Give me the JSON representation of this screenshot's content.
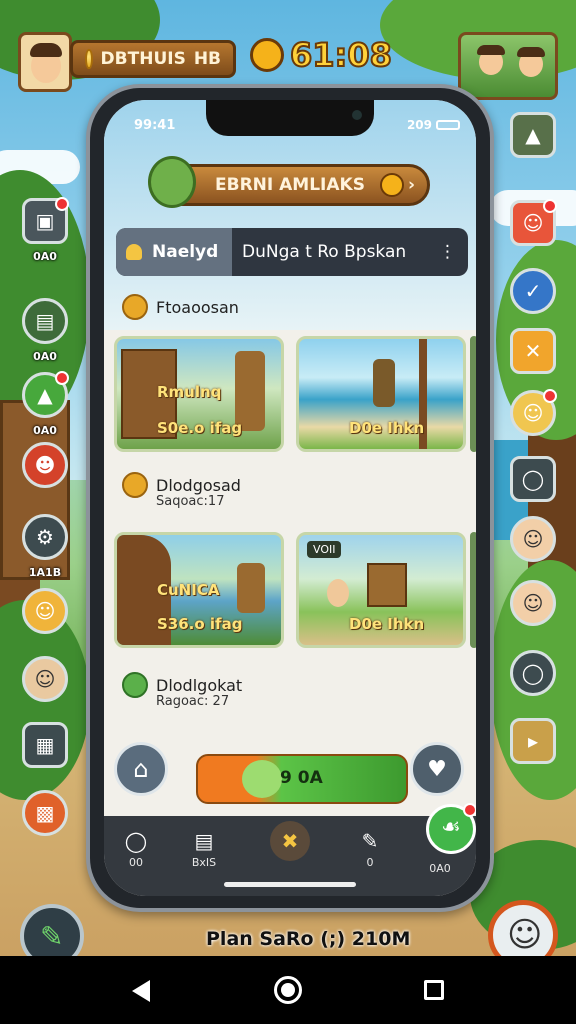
{
  "hud": {
    "player_name": "DBTHUIS",
    "player_suffix": "HB",
    "timer": "61:08"
  },
  "side_left": [
    {
      "label": "0A0",
      "icon": "store-icon"
    },
    {
      "label": "0A0",
      "icon": "map-icon"
    },
    {
      "label": "0A0",
      "icon": "chest-icon"
    },
    {
      "label": "",
      "icon": "mascot-icon"
    },
    {
      "label": "1A1B",
      "icon": "settings-icon"
    },
    {
      "label": "",
      "icon": "explorer-avatar-icon"
    },
    {
      "label": "",
      "icon": "villager-avatar-icon"
    },
    {
      "label": "",
      "icon": "grid-icon"
    },
    {
      "label": "",
      "icon": "calendar-icon"
    }
  ],
  "phone": {
    "status_time": "99:41",
    "status_right": "209",
    "title": "EBRNI AMLIAKS",
    "search": {
      "left_label": "Naelyd",
      "right_label": "DuNga t Ro Bpskan"
    },
    "section1": {
      "title": "Ftoaoosan"
    },
    "cards_row1": [
      {
        "caption_top": "Rmulnq",
        "caption": "S0e.o ifag"
      },
      {
        "caption_top": "",
        "caption": "D0e Ihkn"
      }
    ],
    "section2": {
      "title": "Dlodgosad",
      "subtitle": "Saqoac:17"
    },
    "cards_row2": [
      {
        "tag": "",
        "caption_top": "CuNICA",
        "caption": "S36.o ifag"
      },
      {
        "tag": "VOII",
        "caption_top": "",
        "caption": "D0e Ihkn"
      }
    ],
    "section3": {
      "title": "Dlodlgokat",
      "subtitle": "Ragoac: 27"
    },
    "play_label": "9 0A",
    "tabs": [
      {
        "label": "00",
        "icon": "circle-icon"
      },
      {
        "label": "BxIS",
        "icon": "backpack-icon"
      },
      {
        "label": "",
        "icon": "tools-icon"
      },
      {
        "label": "0",
        "icon": "pen-icon"
      },
      {
        "label": "0A0",
        "icon": "leaf-icon"
      }
    ]
  },
  "bottom": {
    "plan_text": "Plan SaRo (;) 210M"
  },
  "colors": {
    "wood": "#8b5320",
    "green_accent": "#42b649",
    "orange_accent": "#f07a20",
    "tabbar": "#34393f"
  }
}
